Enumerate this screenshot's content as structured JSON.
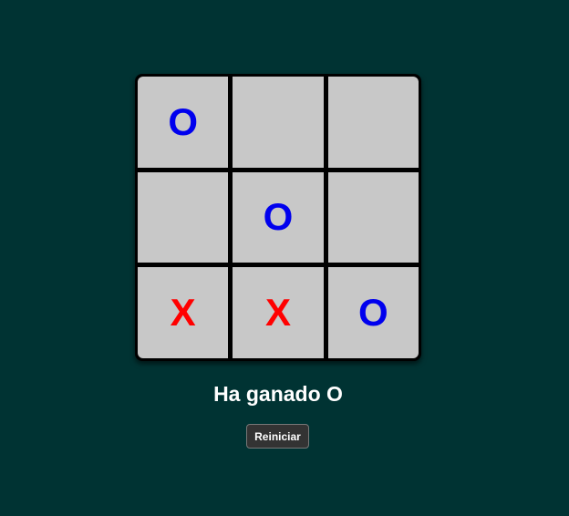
{
  "board": {
    "cells": [
      "O",
      "",
      "",
      "",
      "O",
      "",
      "X",
      "X",
      "O"
    ]
  },
  "colors": {
    "background": "#003333",
    "cell": "#c8c8c8",
    "grid": "#000000",
    "X": "#ff0000",
    "O": "#0000ee"
  },
  "status_text": "Ha ganado O",
  "restart_label": "Reiniciar"
}
